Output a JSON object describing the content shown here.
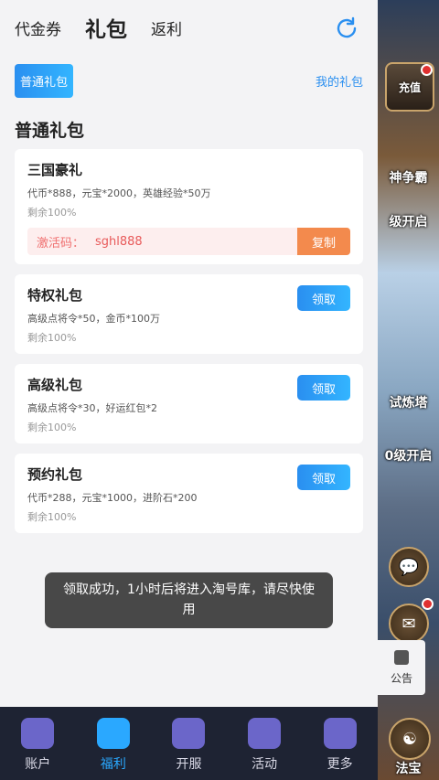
{
  "tabs": [
    "代金券",
    "礼包",
    "返利"
  ],
  "sub_button": "普通礼包",
  "my_gifts": "我的礼包",
  "section_title": "普通礼包",
  "cards": [
    {
      "title": "三国豪礼",
      "desc": "代币*888，元宝*2000，英雄经验*50万",
      "remain": "剩余100%",
      "code_label": "激活码：",
      "code": "sghl888",
      "copy": "复制"
    },
    {
      "title": "特权礼包",
      "desc": "高级点将令*50，金币*100万",
      "remain": "剩余100%",
      "button": "领取"
    },
    {
      "title": "高级礼包",
      "desc": "高级点将令*30，好运红包*2",
      "remain": "剩余100%",
      "button": "领取"
    },
    {
      "title": "预约礼包",
      "desc": "代币*288，元宝*1000，进阶石*200",
      "remain": "剩余100%",
      "button": "领取"
    }
  ],
  "toast": "领取成功，1小时后将进入淘号库，请尽快使用",
  "bottom_nav": [
    {
      "label": "账户",
      "icon": "account-icon"
    },
    {
      "label": "福利",
      "icon": "gift-icon"
    },
    {
      "label": "开服",
      "icon": "gamepad-icon"
    },
    {
      "label": "活动",
      "icon": "controller-icon"
    },
    {
      "label": "更多",
      "icon": "grid-icon"
    }
  ],
  "game_side": {
    "recharge": "充值",
    "label1": "神争霸",
    "label2": "级开启",
    "label3": "试炼塔",
    "label4": "0级开启",
    "notice": "公告",
    "fabao": "法宝"
  },
  "colors": {
    "accent": "#2a8ff0",
    "copy": "#f38a4d",
    "nav_bg": "#1e2333"
  }
}
